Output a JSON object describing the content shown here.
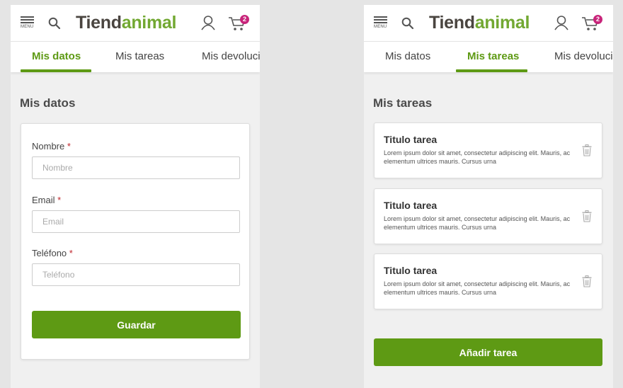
{
  "brand": {
    "part1": "Tiend",
    "part2": "animal"
  },
  "header": {
    "menu_label": "MENU",
    "cart_count": "2"
  },
  "colors": {
    "accent": "#5e9a14",
    "brand_green": "#72a832",
    "brand_dark": "#4a4540",
    "badge": "#c8247a",
    "required": "#c0272d"
  },
  "icons": [
    "menu-icon",
    "search-icon",
    "user-icon",
    "cart-icon",
    "trash-icon"
  ],
  "tabs": [
    {
      "label": "Mis datos"
    },
    {
      "label": "Mis tareas"
    },
    {
      "label": "Mis devoluci"
    }
  ],
  "left_screen": {
    "active_tab": "Mis datos",
    "title": "Mis datos",
    "fields": [
      {
        "label": "Nombre",
        "required_mark": "*",
        "placeholder": "Nombre",
        "value": ""
      },
      {
        "label": "Email",
        "required_mark": "*",
        "placeholder": "Email",
        "value": ""
      },
      {
        "label": "Teléfono",
        "required_mark": "*",
        "placeholder": "Teléfono",
        "value": ""
      }
    ],
    "save_label": "Guardar"
  },
  "right_screen": {
    "active_tab": "Mis tareas",
    "title": "Mis tareas",
    "tasks": [
      {
        "title": "Titulo tarea",
        "description": "Lorem ipsum dolor sit amet, consectetur adipiscing elit. Mauris, ac elementum ultrices mauris. Cursus urna"
      },
      {
        "title": "Titulo tarea",
        "description": "Lorem ipsum dolor sit amet, consectetur adipiscing elit. Mauris, ac elementum ultrices mauris. Cursus urna"
      },
      {
        "title": "Titulo tarea",
        "description": "Lorem ipsum dolor sit amet, consectetur adipiscing elit. Mauris, ac elementum ultrices mauris. Cursus urna"
      }
    ],
    "add_label": "Añadir tarea"
  }
}
